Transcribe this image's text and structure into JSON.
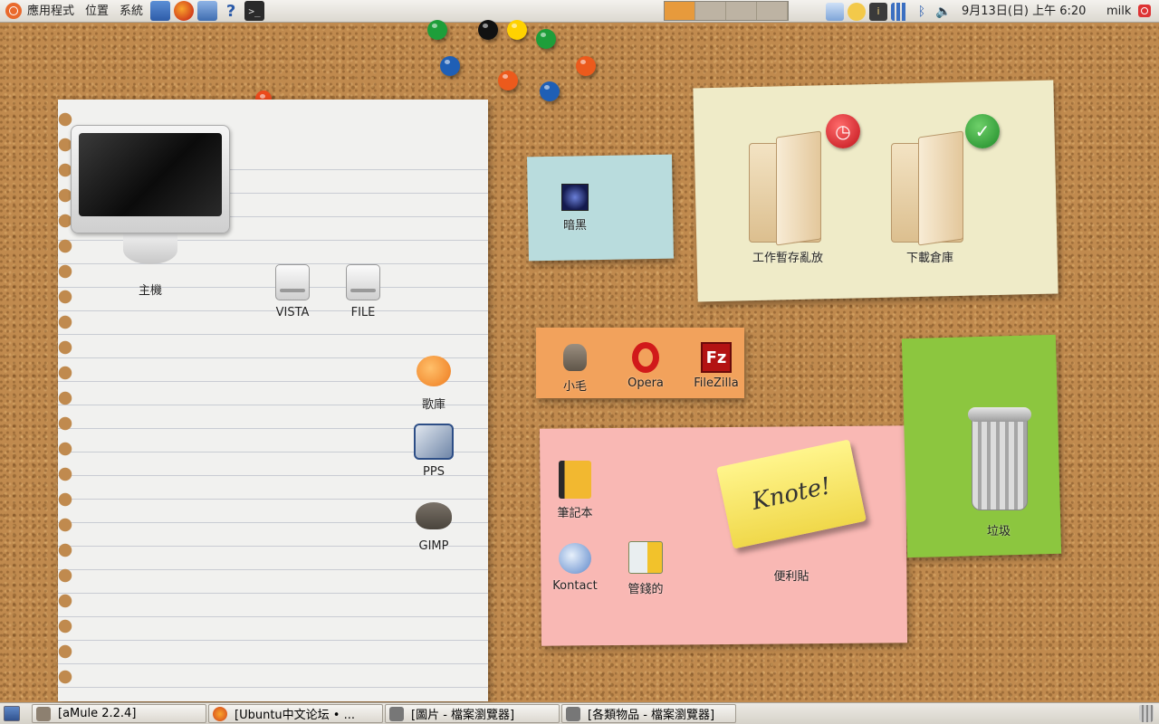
{
  "top_panel": {
    "menus": [
      "應用程式",
      "位置",
      "系統"
    ],
    "launchers": [
      {
        "name": "network-icon"
      },
      {
        "name": "firefox-icon"
      },
      {
        "name": "screenshot-icon"
      },
      {
        "name": "help-icon",
        "glyph": "?"
      },
      {
        "name": "terminal-icon",
        "glyph": ">_"
      }
    ],
    "workspaces": {
      "count": 4,
      "active_index": 0,
      "active_color": "#e79a3c"
    },
    "datetime": "9月13日(日) 上午  6:20",
    "user": "milk"
  },
  "desktop": {
    "computer": "主機",
    "drives": [
      "VISTA",
      "FILE"
    ],
    "paper_apps": [
      "歌庫",
      "PPS",
      "GIMP"
    ],
    "blue_note": {
      "label": "暗黑"
    },
    "cream_note": {
      "folders": [
        "工作暫存亂放",
        "下載倉庫"
      ]
    },
    "orange_note": {
      "apps": [
        "小毛",
        "Opera",
        "FileZilla"
      ]
    },
    "pink_note": {
      "apps": [
        "筆記本",
        "Kontact",
        "管錢的"
      ],
      "knote_label": "便利貼",
      "knote_text": "Knote!"
    },
    "green_note": {
      "trash": "垃圾"
    }
  },
  "taskbar": {
    "tasks": [
      "[aMule 2.2.4]",
      "[Ubuntu中文论坛 • ...",
      "[圖片 - 檔案瀏覽器]",
      "[各類物品 - 檔案瀏覽器]"
    ]
  }
}
